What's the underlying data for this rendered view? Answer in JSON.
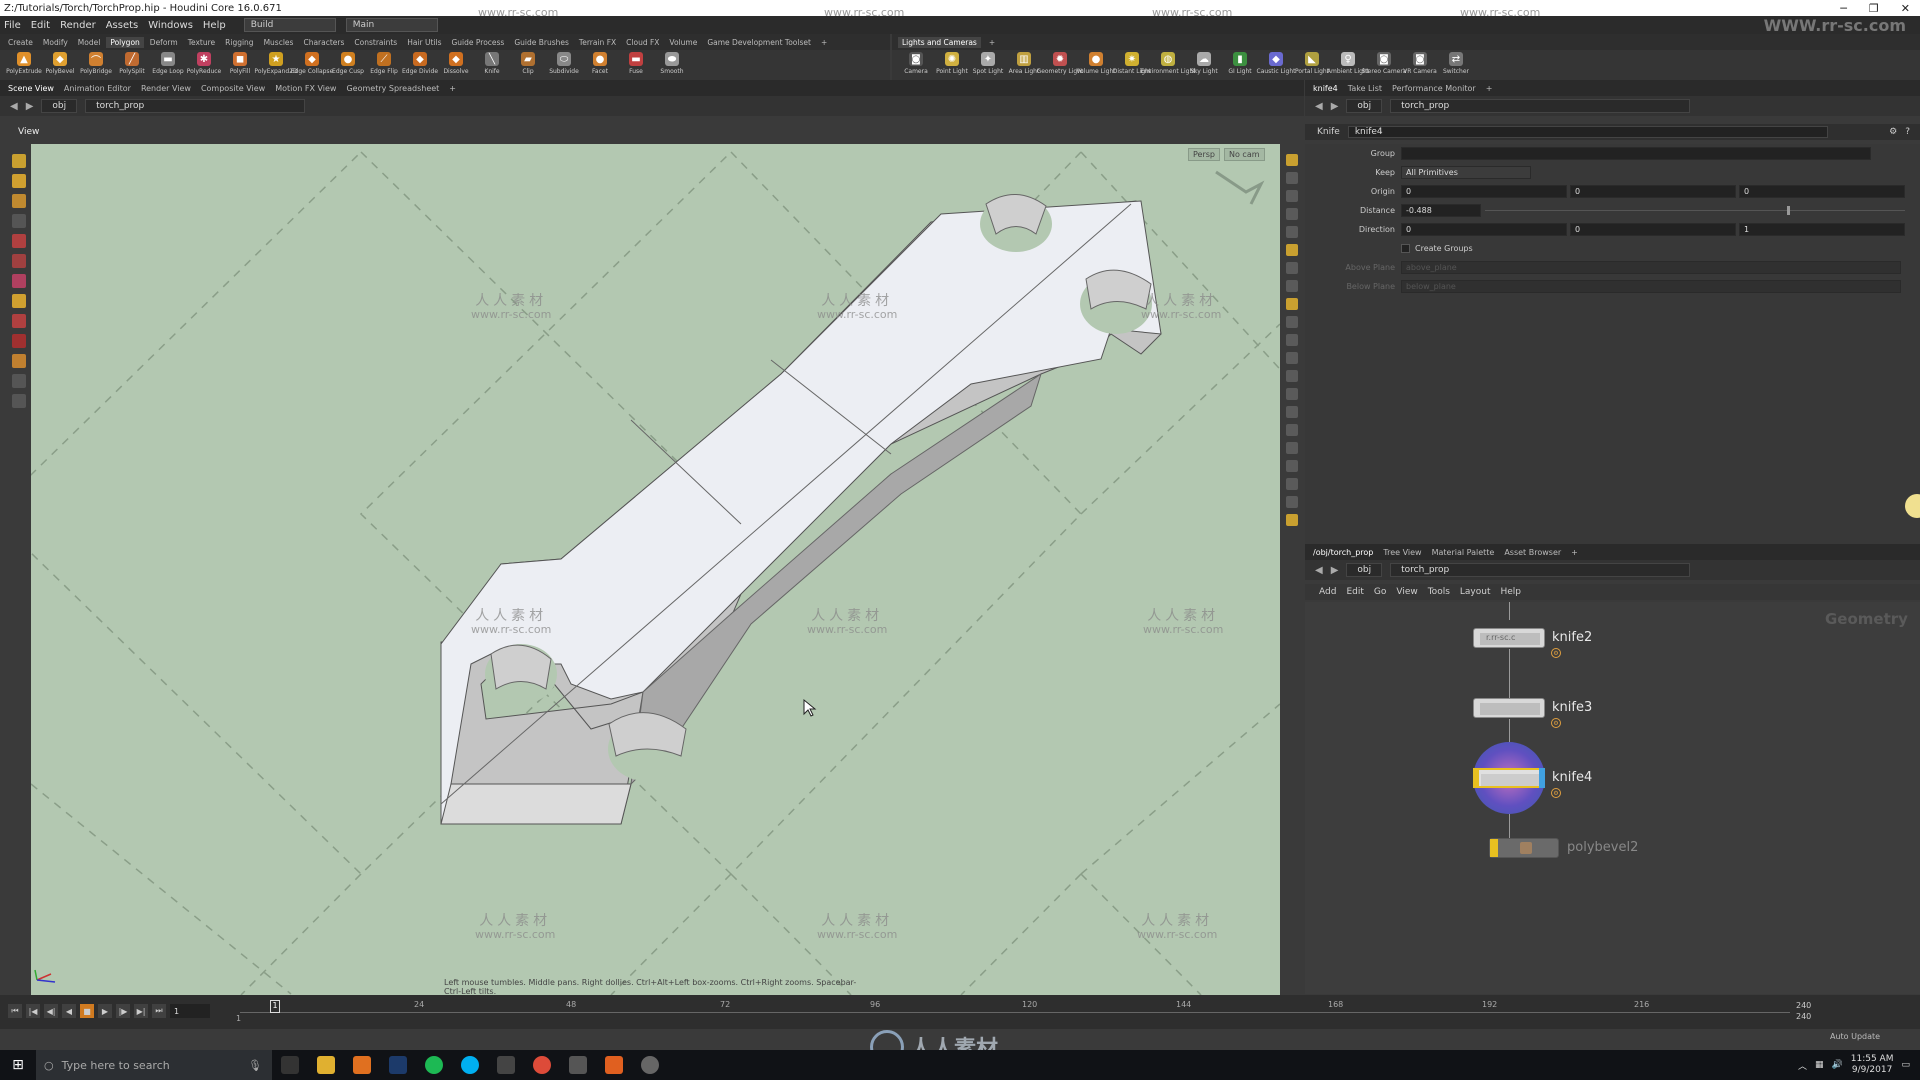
{
  "window": {
    "title": "Z:/Tutorials/Torch/TorchProp.hip - Houdini Core 16.0.671"
  },
  "menu": {
    "items": [
      "File",
      "Edit",
      "Render",
      "Assets",
      "Windows",
      "Help"
    ],
    "desktop": "Build",
    "context": "Main"
  },
  "shelf": {
    "tabs": [
      "Create",
      "Modify",
      "Model",
      "Polygon",
      "Deform",
      "Texture",
      "Rigging",
      "Muscles",
      "Characters",
      "Constraints",
      "Hair Utils",
      "Guide Process",
      "Guide Brushes",
      "Terrain FX",
      "Cloud FX",
      "Volume",
      "Game Development Toolset"
    ],
    "active_tab": "Polygon",
    "tools": [
      "PolyExtrude",
      "PolyBevel",
      "PolyBridge",
      "PolySplit",
      "Edge Loop",
      "PolyReduce",
      "PolyFill",
      "PolyExpand2D",
      "Edge Collapse",
      "Edge Cusp",
      "Edge Flip",
      "Edge Divide",
      "Dissolve",
      "Knife",
      "Clip",
      "Subdivide",
      "Facet",
      "Fuse",
      "Smooth"
    ],
    "tabs2": [
      "Lights and Cameras"
    ],
    "tools2": [
      "Camera",
      "Point Light",
      "Spot Light",
      "Area Light",
      "Geometry Light",
      "Volume Light",
      "Distant Light",
      "Environment Light",
      "Sky Light",
      "GI Light",
      "Caustic Light",
      "Portal Light",
      "Ambient Light",
      "Stereo Camera",
      "VR Camera",
      "Switcher"
    ]
  },
  "panes": {
    "left_tabs": [
      "Scene View",
      "Animation Editor",
      "Render View",
      "Composite View",
      "Motion FX View",
      "Geometry Spreadsheet"
    ],
    "path_root": "obj",
    "path_node": "torch_prop",
    "view_label": "View",
    "persp_btn": "Persp",
    "cam_btn": "No cam",
    "hint": "Left mouse tumbles. Middle pans. Right dollies. Ctrl+Alt+Left box-zooms. Ctrl+Right zooms. Spacebar-Ctrl-Left tilts."
  },
  "watermark": {
    "cn": "人人素材",
    "url": "www.rr-sc.com",
    "top_url": "www.rr-sc.com",
    "corner": "WWW.rr-sc.com",
    "bottom_logo": "人人素材"
  },
  "params": {
    "tabs": [
      "knife4",
      "Take List",
      "Performance Monitor"
    ],
    "path_root": "obj",
    "path_node": "torch_prop",
    "node_type": "Knife",
    "node_name": "knife4",
    "group_label": "Group",
    "group_value": "",
    "keep_label": "Keep",
    "keep_value": "All Primitives",
    "origin_label": "Origin",
    "origin": [
      "0",
      "0",
      "0"
    ],
    "distance_label": "Distance",
    "distance": "-0.488",
    "distance_fraction": 0.72,
    "direction_label": "Direction",
    "direction": [
      "0",
      "0",
      "1"
    ],
    "create_groups_label": "Create Groups",
    "above_plane_label": "Above Plane",
    "above_plane_value": "above_plane",
    "below_plane_label": "Below Plane",
    "below_plane_value": "below_plane"
  },
  "network": {
    "tabs": [
      "/obj/torch_prop",
      "Tree View",
      "Material Palette",
      "Asset Browser"
    ],
    "path_root": "obj",
    "path_node": "torch_prop",
    "menu": [
      "Add",
      "Edit",
      "Go",
      "View",
      "Tools",
      "Layout",
      "Help"
    ],
    "context_label": "Geometry",
    "nodes": [
      "knife2",
      "knife3",
      "knife4",
      "polybevel2"
    ],
    "node_label_partial": "r.rr-sc.c"
  },
  "timeline": {
    "current_frame": "1",
    "start": "1",
    "end_a": "240",
    "end_b": "240",
    "ticks": [
      "24",
      "48",
      "72",
      "96",
      "120",
      "144",
      "168",
      "192",
      "216"
    ],
    "auto_update": "Auto Update"
  },
  "taskbar": {
    "search_placeholder": "Type here to search",
    "time": "11:55 AM",
    "date": "9/9/2017"
  },
  "colors": {
    "viewport_bg": "#b3c8b1",
    "accent_orange": "#d07a20",
    "selected_node": "#e8c020"
  }
}
